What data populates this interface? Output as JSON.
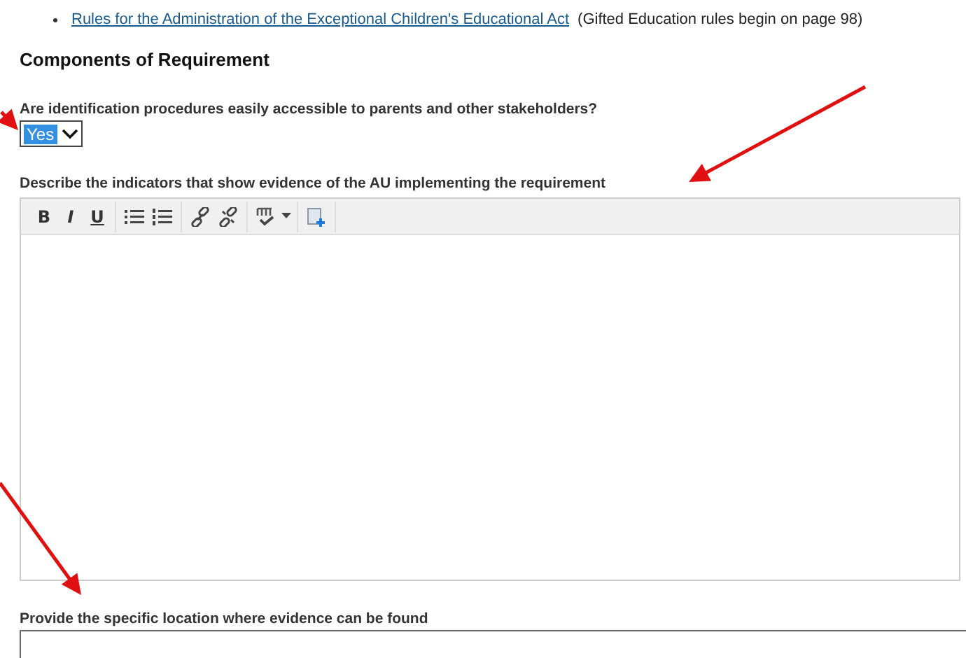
{
  "references": [
    {
      "link": "Rules for the Administration of the Exceptional Children's Educational Act",
      "note": "(Gifted Education rules begin on page 98)"
    }
  ],
  "heading": "Components of Requirement",
  "question": {
    "label": "Are identification procedures easily accessible to parents and other stakeholders?",
    "value": "Yes",
    "highlighted": true
  },
  "indicators": {
    "label": "Describe the indicators that show evidence of the AU implementing the requirement",
    "toolbar_letters": [
      "B",
      "I",
      "U"
    ]
  },
  "location": {
    "label": "Provide the specific location where evidence can be found"
  }
}
